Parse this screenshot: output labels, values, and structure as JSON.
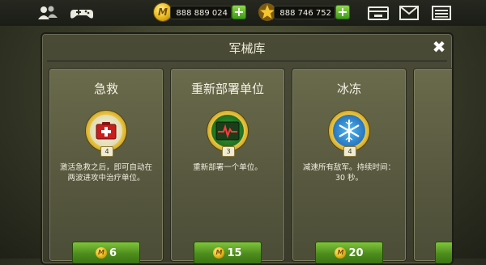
{
  "currency": {
    "coin_icon": "m-coin-icon",
    "coins": "888 889 024",
    "star_icon": "star-icon",
    "stars": "888 746 752",
    "coin_glyph": "M"
  },
  "modal": {
    "title": "军械库",
    "close": "✖"
  },
  "cards": [
    {
      "title": "急救",
      "level": "4",
      "description": "激活急救之后，即可自动在两波进攻中治疗单位。",
      "price": "6",
      "icon": "first-aid-kit-icon"
    },
    {
      "title": "重新部署单位",
      "level": "3",
      "description": "重新部署一个单位。",
      "price": "15",
      "icon": "redeploy-heartbeat-icon"
    },
    {
      "title": "冰冻",
      "level": "4",
      "description": "减速所有敌军。持续时间：30 秒。",
      "price": "20",
      "icon": "snowflake-icon"
    }
  ]
}
